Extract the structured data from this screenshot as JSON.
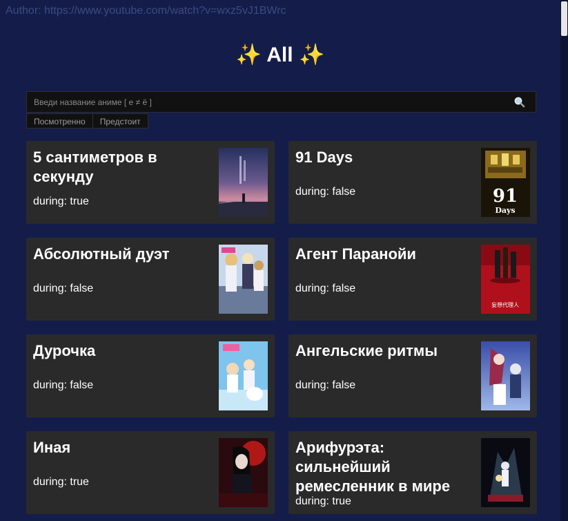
{
  "author": "Author: https://www.youtube.com/watch?v=wxz5vJ1BWrc",
  "header": {
    "sparkle_left": "✨",
    "title": "All",
    "sparkle_right": "✨"
  },
  "search": {
    "placeholder": "Введи название аниме [ е ≠ ё ]",
    "value": "",
    "button_icon": "search-icon"
  },
  "filters": [
    "Посмотренно",
    "Предстоит"
  ],
  "cards": [
    {
      "name": "5 сантиметров в секунду",
      "status": "during: true",
      "poster": "5-centimeters-poster"
    },
    {
      "name": "91 Days",
      "status": "during: false",
      "poster": "91-days-poster",
      "poster_text": "91",
      "poster_subtext": "Days"
    },
    {
      "name": "Абсолютный дуэт",
      "status": "during: false",
      "poster": "absolute-duo-poster"
    },
    {
      "name": "Агент Паранойи",
      "status": "during: false",
      "poster": "paranoia-agent-poster",
      "poster_text": "妄想代理人"
    },
    {
      "name": "Дурочка",
      "status": "during: false",
      "poster": "durochka-poster"
    },
    {
      "name": "Ангельские ритмы",
      "status": "during: false",
      "poster": "angel-beats-poster"
    },
    {
      "name": "Иная",
      "status": "during: true",
      "poster": "another-poster"
    },
    {
      "name": "Арифурэта: сильнейший ремесленник в мире",
      "status": "during: true",
      "poster": "arifureta-poster"
    }
  ],
  "colors": {
    "background": "#141d4a",
    "card": "#2a2a2a",
    "text": "#ffffff",
    "author": "#3c4a83"
  }
}
